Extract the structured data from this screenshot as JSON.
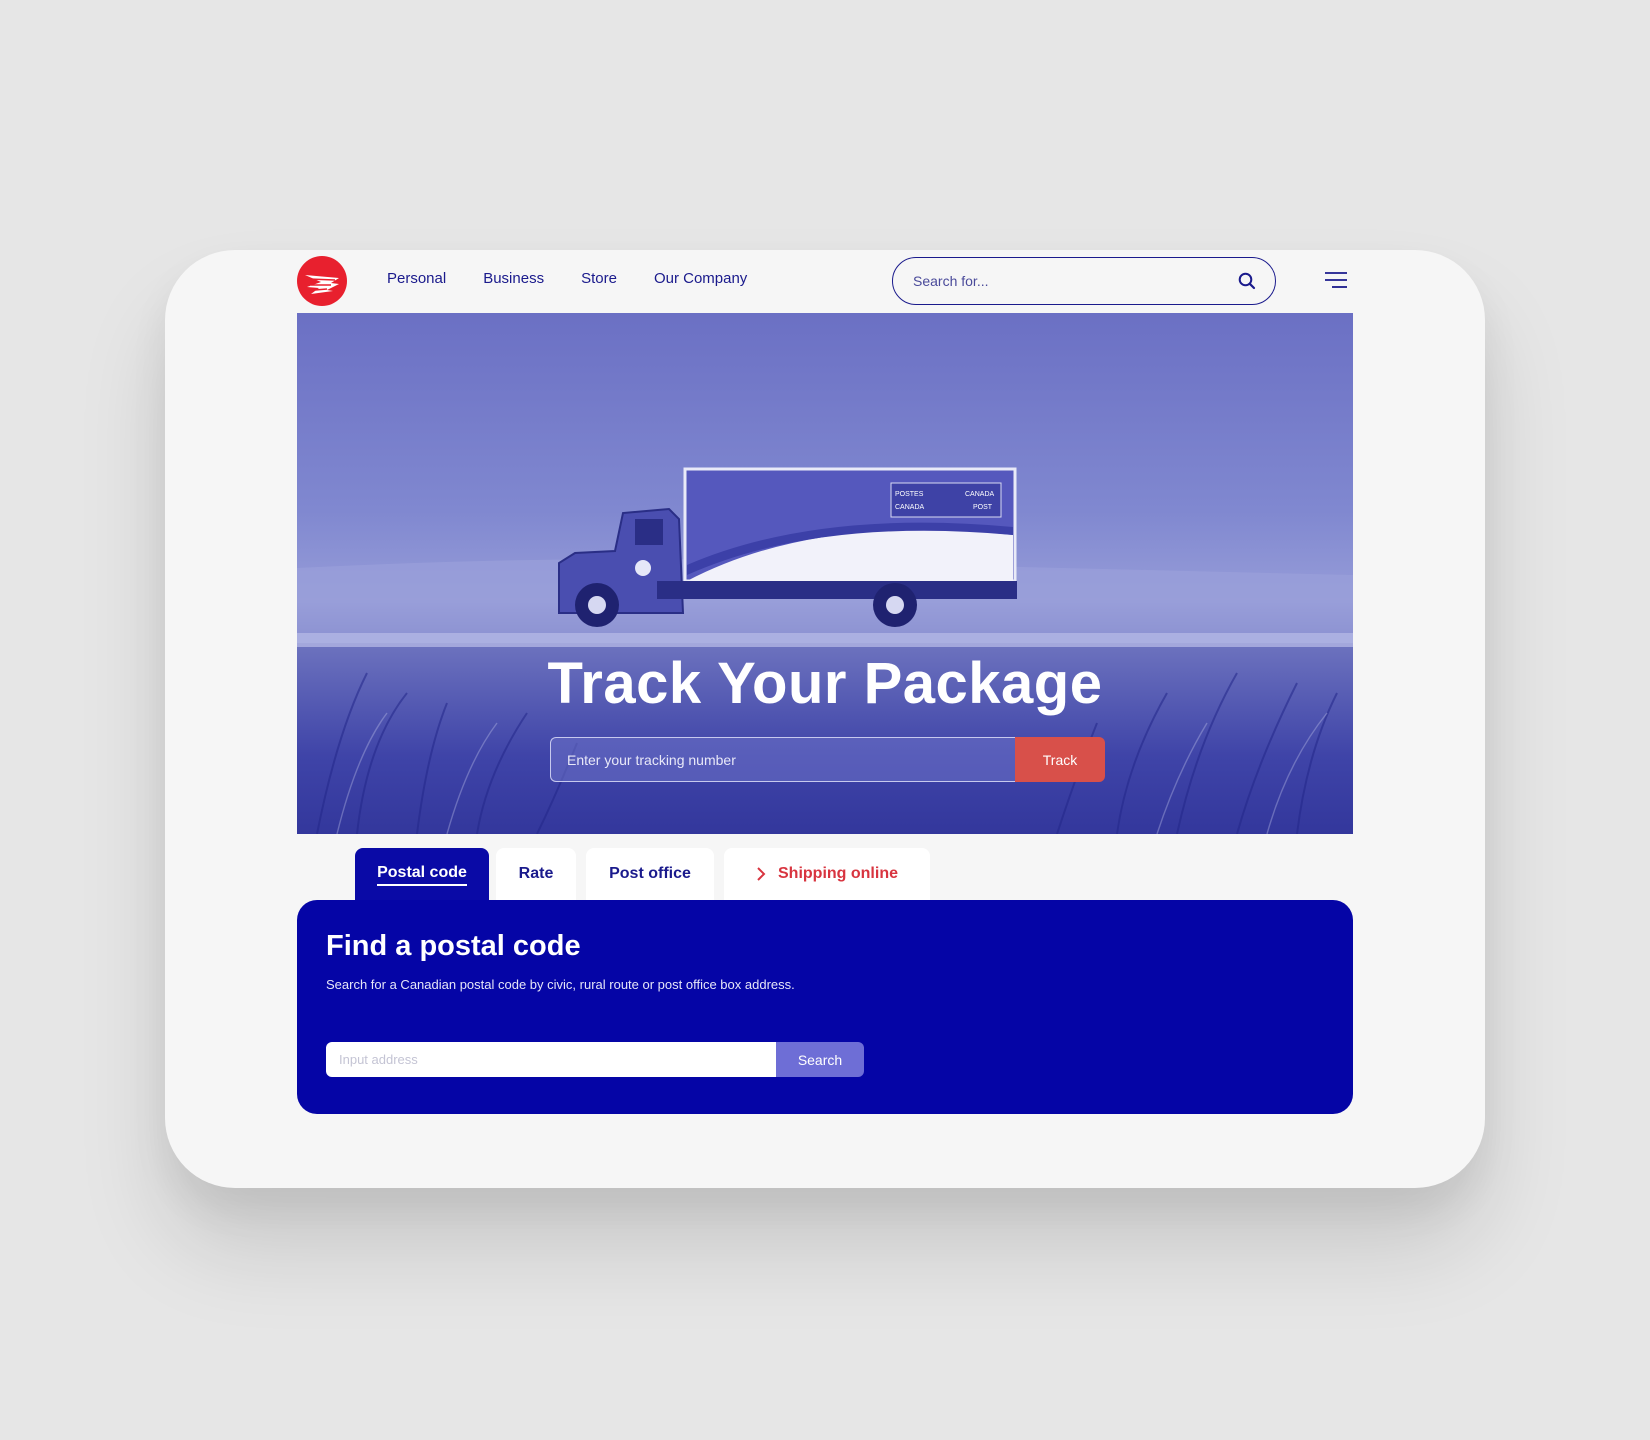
{
  "brand": {
    "name": "Canada Post",
    "logo_icon": "canada-post-eagle-logo",
    "accent": "#e8202e",
    "primary": "#1a1a8c"
  },
  "nav": {
    "items": [
      {
        "label": "Personal"
      },
      {
        "label": "Business"
      },
      {
        "label": "Store"
      },
      {
        "label": "Our Company"
      }
    ]
  },
  "search": {
    "placeholder": "Search for...",
    "icon": "search-icon"
  },
  "menu": {
    "icon": "hamburger-menu-icon"
  },
  "hero": {
    "title": "Track Your Package",
    "tracking_placeholder": "Enter your tracking number",
    "track_label": "Track",
    "truck_sign": {
      "line1_left": "POSTES",
      "line1_right": "CANADA",
      "line2_left": "CANADA",
      "line2_right": "POST"
    }
  },
  "tabs": [
    {
      "label": "Postal code",
      "active": true
    },
    {
      "label": "Rate"
    },
    {
      "label": "Post office"
    },
    {
      "label": "Shipping online",
      "icon": "chevron-right-icon"
    }
  ],
  "postal": {
    "title": "Find a postal code",
    "description": "Search for a Canadian postal code by civic, rural route or post office box address.",
    "input_placeholder": "Input address",
    "search_label": "Search"
  }
}
